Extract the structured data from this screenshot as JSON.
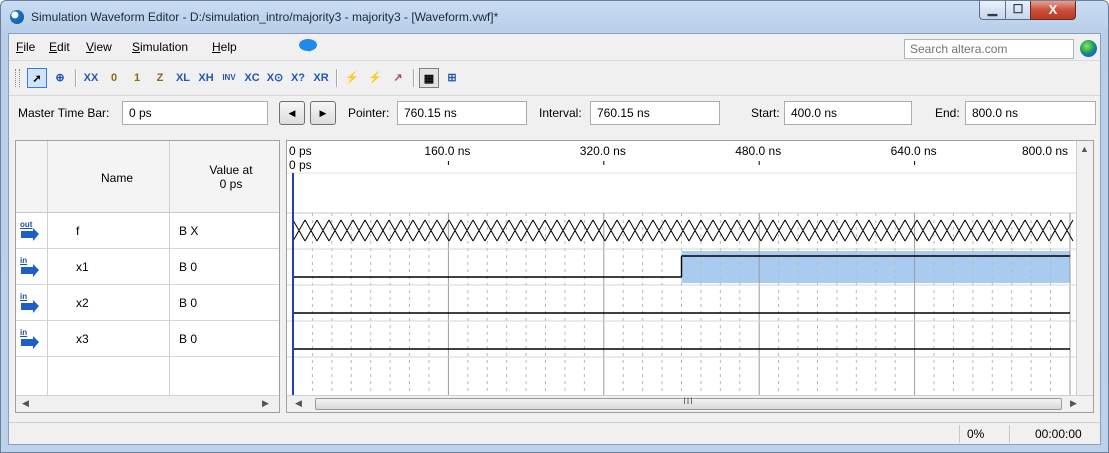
{
  "window": {
    "title": "Simulation Waveform Editor - D:/simulation_intro/majority3 - majority3 - [Waveform.vwf]*",
    "controls": {
      "minimize": "▁",
      "maximize": "☐",
      "close": "X"
    }
  },
  "menu": [
    {
      "key": "F",
      "rest": "ile"
    },
    {
      "key": "E",
      "rest": "dit"
    },
    {
      "key": "V",
      "rest": "iew"
    },
    {
      "key": "S",
      "rest": "imulation"
    },
    {
      "key": "H",
      "rest": "elp"
    }
  ],
  "search": {
    "placeholder": "Search altera.com"
  },
  "toolbar": [
    {
      "name": "selection-tool-icon",
      "glyph": "➚",
      "style": "sel"
    },
    {
      "name": "zoom-tool-icon",
      "glyph": "⊕",
      "style": "blue"
    },
    {
      "name": "forcing-unknown-icon",
      "glyph": "XX",
      "style": "blue"
    },
    {
      "name": "forcing-low-icon",
      "glyph": "0",
      "style": "gold"
    },
    {
      "name": "forcing-high-icon",
      "glyph": "1",
      "style": "gold"
    },
    {
      "name": "high-impedance-icon",
      "glyph": "Z",
      "style": "gold"
    },
    {
      "name": "weak-low-icon",
      "glyph": "XL",
      "style": "blue"
    },
    {
      "name": "weak-high-icon",
      "glyph": "XH",
      "style": "blue"
    },
    {
      "name": "invert-icon",
      "glyph": "INV",
      "style": "blue"
    },
    {
      "name": "count-value-icon",
      "glyph": "XC",
      "style": "blue"
    },
    {
      "name": "overwrite-clock-icon",
      "glyph": "X⊙",
      "style": "blue"
    },
    {
      "name": "arbitrary-value-icon",
      "glyph": "X?",
      "style": "blue"
    },
    {
      "name": "random-value-icon",
      "glyph": "XR",
      "style": "blue"
    },
    {
      "name": "run-functional-simulation-icon",
      "glyph": "⚡",
      "style": "pink"
    },
    {
      "name": "run-timing-simulation-icon",
      "glyph": "⚡",
      "style": "pink"
    },
    {
      "name": "generate-netlist-icon",
      "glyph": "↗",
      "style": "pink"
    },
    {
      "name": "snap-to-grid-icon",
      "glyph": "▦",
      "style": "pressed"
    },
    {
      "name": "sort-icon",
      "glyph": "⊞",
      "style": "blue"
    }
  ],
  "timebar": {
    "master_label": "Master Time Bar:",
    "master_value": "0 ps",
    "pointer_label": "Pointer:",
    "pointer_value": "760.15 ns",
    "interval_label": "Interval:",
    "interval_value": "760.15 ns",
    "start_label": "Start:",
    "start_value": "400.0 ns",
    "end_label": "End:",
    "end_value": "800.0 ns"
  },
  "grid": {
    "col_name": "Name",
    "col_value_line1": "Value at",
    "col_value_line2": "0 ps",
    "time_ticks": [
      "0 ps",
      "160.0 ns",
      "320.0 ns",
      "480.0 ns",
      "640.0 ns",
      "800.0 ns"
    ],
    "master_marker": "0 ps",
    "time_range_ns": [
      0,
      800
    ],
    "signals": [
      {
        "pin": "out",
        "name": "f",
        "value": "B X",
        "wave": [
          {
            "t0": 0,
            "t1": 800,
            "v": "X"
          }
        ]
      },
      {
        "pin": "in",
        "name": "x1",
        "value": "B 0",
        "wave": [
          {
            "t0": 0,
            "t1": 400,
            "v": "0"
          },
          {
            "t0": 400,
            "t1": 800,
            "v": "1"
          }
        ],
        "selected_ns": [
          400,
          800
        ]
      },
      {
        "pin": "in",
        "name": "x2",
        "value": "B 0",
        "wave": [
          {
            "t0": 0,
            "t1": 800,
            "v": "0"
          }
        ]
      },
      {
        "pin": "in",
        "name": "x3",
        "value": "B 0",
        "wave": [
          {
            "t0": 0,
            "t1": 800,
            "v": "0"
          }
        ]
      }
    ],
    "scroll_thumb_glyph": "III"
  },
  "status": {
    "progress": "0%",
    "elapsed": "00:00:00"
  },
  "colors": {
    "selection": "#a9cbef",
    "cursor": "#1f3fbf"
  }
}
